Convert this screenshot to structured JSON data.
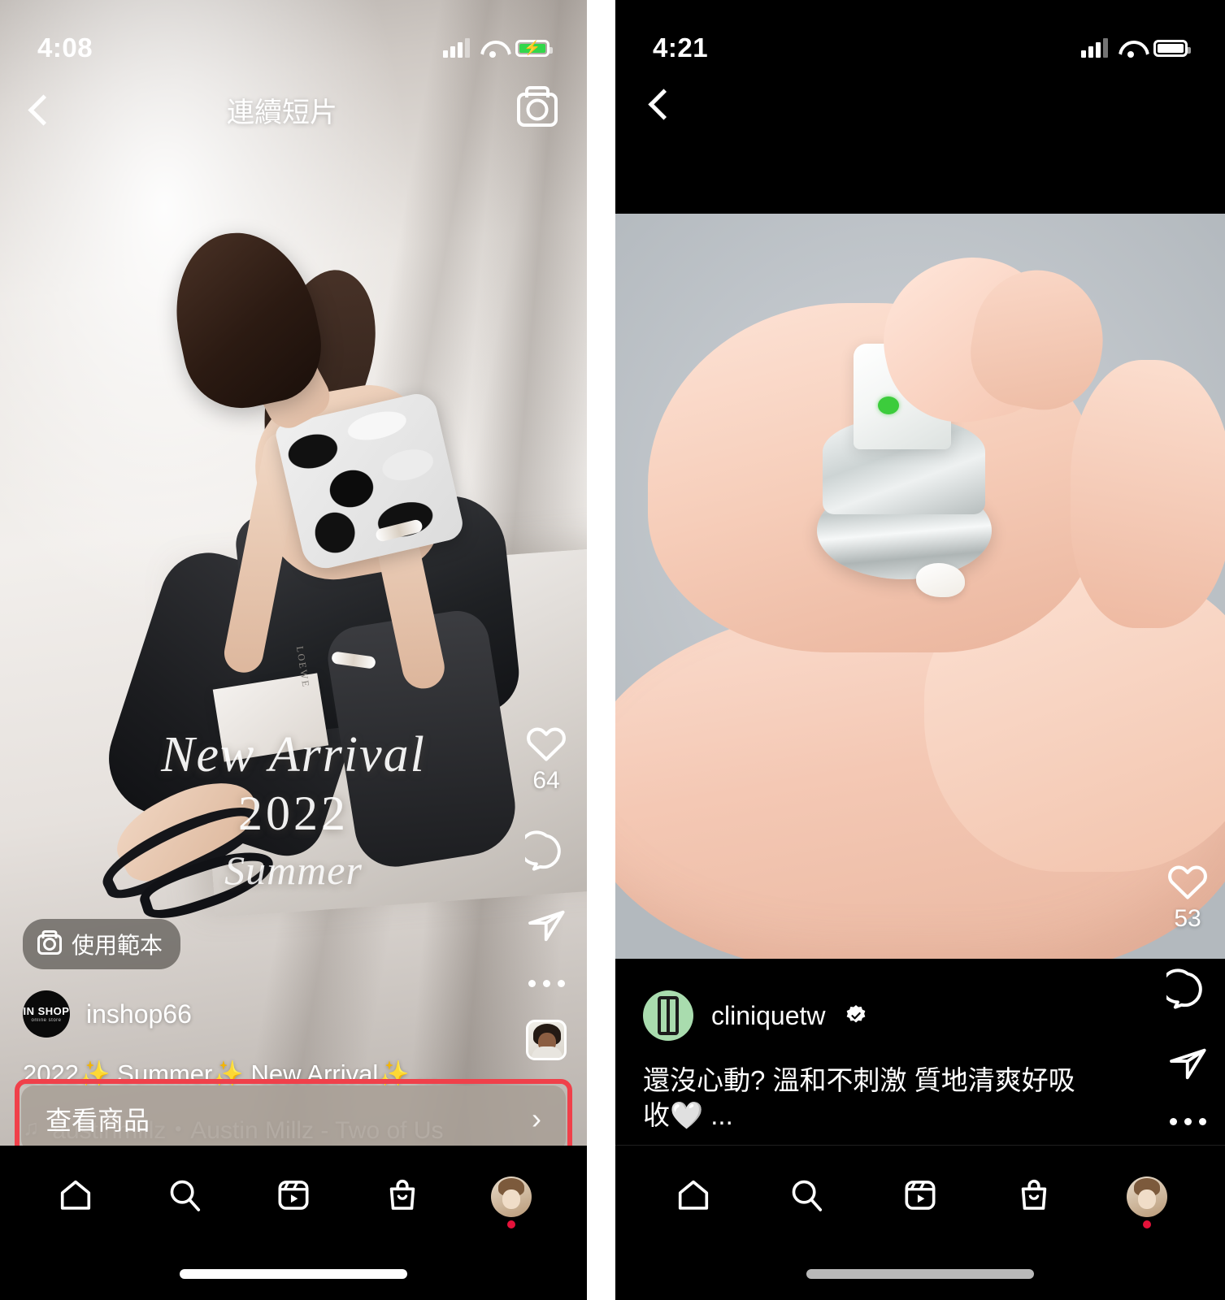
{
  "left_phone": {
    "status_bar": {
      "time": "4:08",
      "signal": "cellular-signal",
      "wifi": "wifi-icon",
      "battery": "battery-charging-icon",
      "battery_charging": true
    },
    "top_bar": {
      "back": "back-chevron",
      "title": "連續短片",
      "camera": "camera-icon"
    },
    "overlay_text": {
      "line1": "New Arrival",
      "line2": "2022",
      "line3": "Summer"
    },
    "action_rail": {
      "like_icon": "heart-icon",
      "like_count": "64",
      "comment_icon": "comment-bubble-icon",
      "share_icon": "paper-plane-icon",
      "more_icon": "more-options-icon",
      "audio_thumb": "audio-track-thumbnail"
    },
    "template_badge": {
      "icon": "camera-icon",
      "label": "使用範本"
    },
    "account": {
      "avatar_line1": "IN SHOP",
      "avatar_line2": "online store",
      "username": "inshop66"
    },
    "caption": "2022✨ Summer✨ New Arrival✨",
    "caption_more": "...",
    "audio": {
      "note_icon": "music-note-icon",
      "text": "austinmillz・Austin Millz - Two of Us"
    },
    "cta": {
      "label": "查看商品",
      "chevron": "chevron-right-icon",
      "highlight_color": "#f0404a"
    },
    "nav": [
      {
        "name": "home-icon",
        "label": "首頁"
      },
      {
        "name": "search-icon",
        "label": "搜尋"
      },
      {
        "name": "reels-icon",
        "label": "連續短片"
      },
      {
        "name": "shop-icon",
        "label": "商店"
      },
      {
        "name": "profile-avatar",
        "label": "個人檔案"
      }
    ],
    "nav_badge": true
  },
  "right_phone": {
    "status_bar": {
      "time": "4:21",
      "signal": "cellular-signal",
      "wifi": "wifi-icon",
      "battery": "battery-icon",
      "battery_charging": false
    },
    "top_bar": {
      "back": "back-chevron"
    },
    "action_rail": {
      "like_icon": "heart-icon",
      "like_count": "53",
      "comment_icon": "comment-bubble-icon",
      "share_icon": "paper-plane-icon",
      "more_icon": "more-options-icon"
    },
    "account": {
      "avatar": "clinique-logo-avatar",
      "avatar_color": "#a9dcae",
      "username": "cliniquetw",
      "verified": true,
      "verified_icon": "verified-badge-icon"
    },
    "caption": "還沒心動? 溫和不刺激 質地清爽好吸收🤍",
    "caption_more": "...",
    "nav": [
      {
        "name": "home-icon",
        "label": "首頁"
      },
      {
        "name": "search-icon",
        "label": "搜尋"
      },
      {
        "name": "reels-icon",
        "label": "連續短片"
      },
      {
        "name": "shop-icon",
        "label": "商店"
      },
      {
        "name": "profile-avatar",
        "label": "個人檔案"
      }
    ],
    "nav_badge": true
  }
}
